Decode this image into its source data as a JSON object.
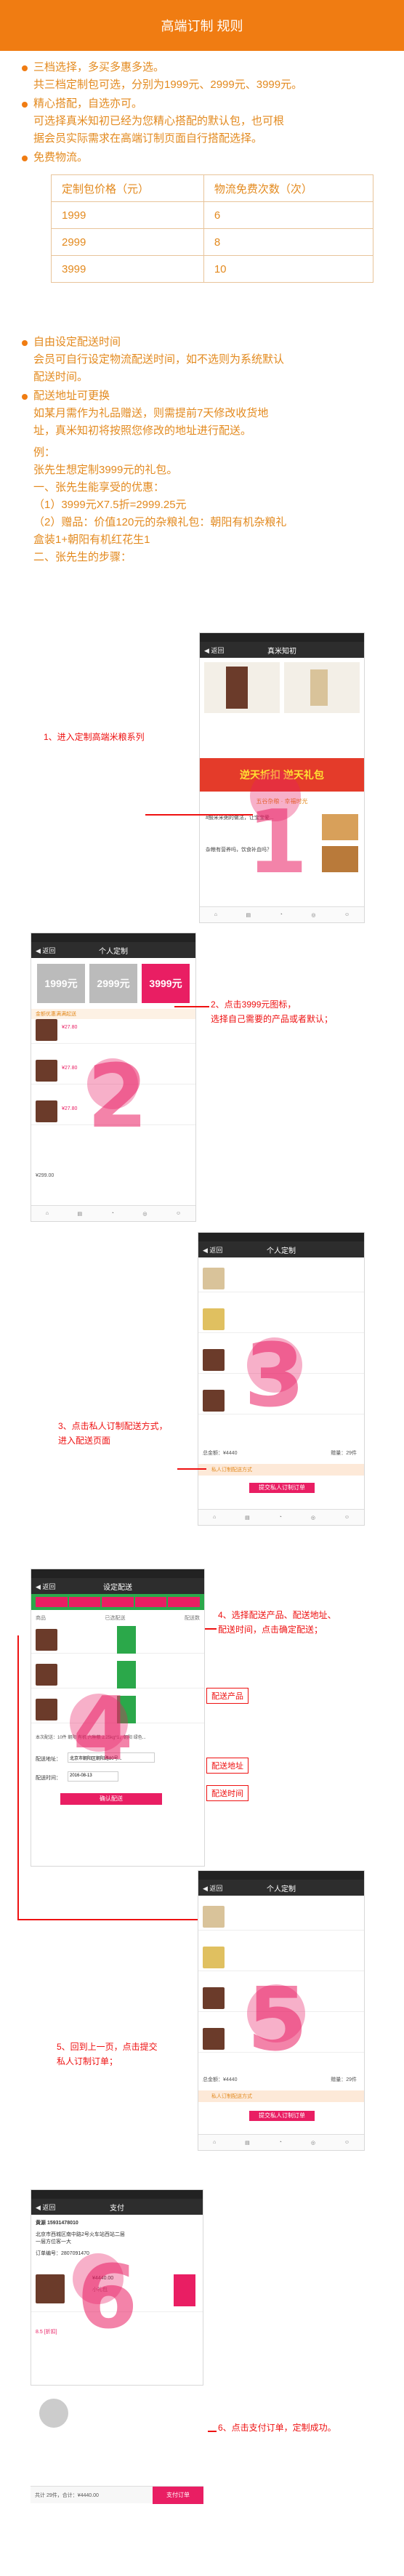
{
  "header": {
    "title": "高端订制 规则"
  },
  "intro": {
    "b1": [
      "三档选择，多买多惠多选。",
      "共三档定制包可选，分别为1999元、2999元、3999元。"
    ],
    "b2": [
      "精心搭配，自选亦可。",
      "可选择真米知初已经为您精心搭配的默认包，也可根",
      "据会员实际需求在高端订制页面自行搭配选择。"
    ],
    "b3": [
      "免费物流。"
    ]
  },
  "price_table": {
    "headers": [
      "定制包价格（元）",
      "物流免费次数（次）"
    ],
    "rows": [
      [
        "1999",
        "6"
      ],
      [
        "2999",
        "8"
      ],
      [
        "3999",
        "10"
      ]
    ]
  },
  "details": {
    "b4": [
      "自由设定配送时间",
      "会员可自行设定物流配送时间，如不选则为系统默认",
      "配送时间。"
    ],
    "b5": [
      "配送地址可更换",
      "如某月需作为礼品赠送，则需提前7天修改收货地",
      "址，真米知初将按照您修改的地址进行配送。"
    ],
    "example": [
      "例：",
      "张先生想定制3999元的礼包。",
      "一、张先生能享受的优惠：",
      "（1）3999元X7.5折=2999.25元",
      "（2）赠品：价值120元的杂粮礼包：朝阳有机杂粮礼",
      "盒装1+朝阳有机红花生1",
      "二、张先生的步骤："
    ]
  },
  "steps": {
    "s1": {
      "text": "1、进入定制高端米粮系列",
      "num": "1"
    },
    "s2": {
      "text": [
        "2、点击3999元图标，",
        "选择自己需要的产品或者默认；"
      ],
      "num": "2"
    },
    "s3": {
      "text": [
        "3、点击私人订制配送方式，",
        "进入配送页面"
      ],
      "num": "3"
    },
    "s4": {
      "text": [
        "4、选择配送产品、配送地址、",
        "配送时间，点击确定配送；"
      ],
      "num": "4",
      "labels": [
        "配送产品",
        "配送地址",
        "配送时间"
      ]
    },
    "s5": {
      "text": [
        "5、回到上一页，点击提交",
        "私人订制订单；"
      ],
      "num": "5"
    },
    "s6": {
      "text": "6、点击支付订单，定制成功。",
      "num": "6"
    }
  },
  "screens": {
    "s1": {
      "nav": "真米知初",
      "banner": "逆天折扣 逆天礼包",
      "section": "五谷杂粮 · 幸福时光",
      "item1": "#酸米米粥的做法，让宝宝爱...",
      "item2": "杂粮有营养吗，饮食补血吗？"
    },
    "s2": {
      "nav": "个人定制",
      "tabs": [
        "1999元",
        "2999元",
        "3999元"
      ],
      "note": "金额优惠满满起送",
      "price": "¥27.80",
      "total": "¥299.00"
    },
    "s3": {
      "nav": "个人定制",
      "total_label": "总金额：¥4440",
      "weight": "赠量：29件",
      "delivery": "私人订制配送方式",
      "submit": "提交私人订制订单"
    },
    "s4": {
      "nav": "设定配送",
      "cols": [
        "商品",
        "已选配送",
        "配送数"
      ],
      "summary": "本次配送：10件 朝阳 有机 六种粮 2.25kg*1，朝阳 绿色...",
      "addr_label": "配送地址：",
      "addr_value": "北京市朝阳区朝阳路80号...",
      "time_label": "配送时间：",
      "time_value": "2016-08-13",
      "confirm": "确认配送"
    },
    "s5": {
      "nav": "个人定制",
      "total_label": "总金额：¥4440",
      "weight": "赠量：29件",
      "delivery": "私人订制配送方式",
      "submit": "提交私人订制订单"
    },
    "s6": {
      "nav": "支付",
      "name": "黄源 15931478010",
      "address": "北京市西城区南中路2号火车站西站二层",
      "address2": "一层方位客一大",
      "order_no": "订单编号：2807091470",
      "amount": "¥4440.00",
      "qty": "小礼包",
      "total_left": "共计 29件，合计：¥4440.00",
      "pay": "支付订单",
      "discount": "8.5 [折扣]"
    }
  },
  "colors": {
    "accent": "#f07c12",
    "text": "#e38a1f",
    "pink": "#e91e63",
    "red": "#ee1111"
  }
}
